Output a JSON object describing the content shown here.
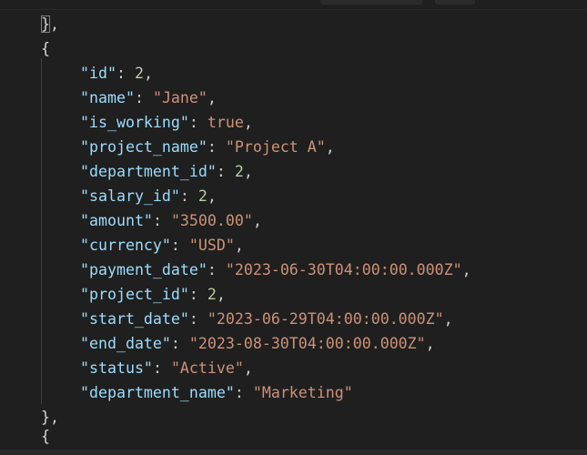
{
  "editor": {
    "lines": [
      {
        "open": "}",
        "close": ","
      },
      {
        "open": "{"
      },
      {
        "key": "\"id\"",
        "value": "2",
        "vtype": "num"
      },
      {
        "key": "\"name\"",
        "value": "\"Jane\"",
        "vtype": "str"
      },
      {
        "key": "\"is_working\"",
        "value": "true",
        "vtype": "bool"
      },
      {
        "key": "\"project_name\"",
        "value": "\"Project A\"",
        "vtype": "str"
      },
      {
        "key": "\"department_id\"",
        "value": "2",
        "vtype": "num"
      },
      {
        "key": "\"salary_id\"",
        "value": "2",
        "vtype": "num"
      },
      {
        "key": "\"amount\"",
        "value": "\"3500.00\"",
        "vtype": "str"
      },
      {
        "key": "\"currency\"",
        "value": "\"USD\"",
        "vtype": "str"
      },
      {
        "key": "\"payment_date\"",
        "value": "\"2023-06-30T04:00:00.000Z\"",
        "vtype": "str"
      },
      {
        "key": "\"project_id\"",
        "value": "2",
        "vtype": "num"
      },
      {
        "key": "\"start_date\"",
        "value": "\"2023-06-29T04:00:00.000Z\"",
        "vtype": "str"
      },
      {
        "key": "\"end_date\"",
        "value": "\"2023-08-30T04:00:00.000Z\"",
        "vtype": "str"
      },
      {
        "key": "\"status\"",
        "value": "\"Active\"",
        "vtype": "str"
      },
      {
        "key": "\"department_name\"",
        "value": "\"Marketing\"",
        "vtype": "str"
      },
      {
        "open": "}",
        "close": ","
      },
      {
        "open": "{"
      }
    ],
    "separator": ":",
    "comma": ","
  },
  "colors": {
    "background": "#1f1f1f",
    "key": "#9cdcfe",
    "number": "#b5cea8",
    "string": "#ce9178",
    "punctuation": "#cccccc"
  }
}
